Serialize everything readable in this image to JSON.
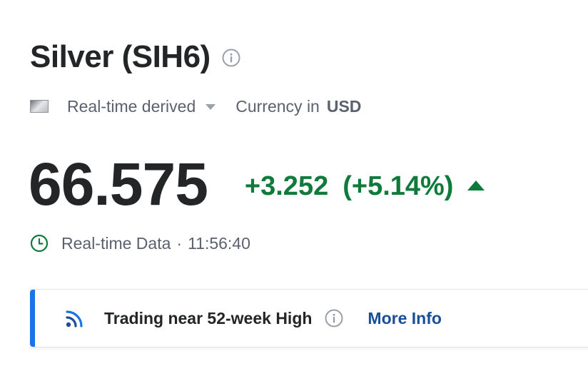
{
  "instrument": {
    "title": "Silver (SIH6)"
  },
  "meta": {
    "realtime_label": "Real-time derived",
    "currency_label": "Currency in",
    "currency_code": "USD"
  },
  "quote": {
    "price": "66.575",
    "change": "+3.252",
    "change_percent": "(+5.14%)",
    "direction": "up",
    "positive_color": "#0f7b3a"
  },
  "status": {
    "label": "Real-time Data",
    "separator": "·",
    "time": "11:56:40"
  },
  "banner": {
    "text": "Trading near 52-week High",
    "link_label": "More Info",
    "accent_color": "#1a73e8",
    "icon": "signal-icon"
  },
  "icons": {
    "title_info": "info-icon",
    "clock": "clock-icon",
    "flag": "flag-icon",
    "dropdown": "chevron-down-icon",
    "trend": "arrow-up-icon"
  }
}
